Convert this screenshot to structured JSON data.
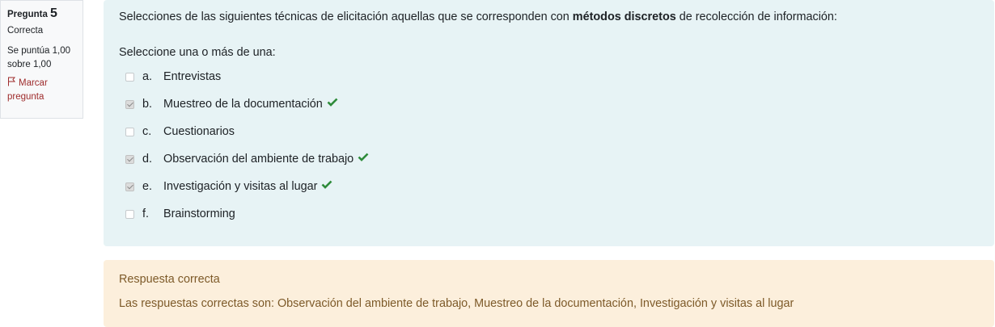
{
  "info": {
    "question_label": "Pregunta",
    "question_number": "5",
    "state": "Correcta",
    "grade": "Se puntúa 1,00 sobre 1,00",
    "flag_label": "Marcar pregunta",
    "flag_color": "#9e2b2b"
  },
  "question": {
    "text_before": "Selecciones de las siguientes técnicas de elicitación aquellas que se corresponden con ",
    "text_bold": "métodos discretos",
    "text_after": " de recolección de información:",
    "prompt": "Seleccione una o más de una:",
    "options": [
      {
        "letter": "a.",
        "label": "Entrevistas",
        "checked": false,
        "correct": false
      },
      {
        "letter": "b.",
        "label": "Muestreo de la documentación",
        "checked": true,
        "correct": true
      },
      {
        "letter": "c.",
        "label": "Cuestionarios",
        "checked": false,
        "correct": false
      },
      {
        "letter": "d.",
        "label": "Observación del ambiente de trabajo",
        "checked": true,
        "correct": true
      },
      {
        "letter": "e.",
        "label": "Investigación y visitas al lugar",
        "checked": true,
        "correct": true
      },
      {
        "letter": "f.",
        "label": "Brainstorming",
        "checked": false,
        "correct": false
      }
    ]
  },
  "feedback": {
    "status": "Respuesta correcta",
    "correct_answers": "Las respuestas correctas son: Observación del ambiente de trabajo, Muestreo de la documentación, Investigación y visitas al lugar"
  },
  "colors": {
    "formulation_bg": "#e7f3f5",
    "feedback_bg": "#fcefdc",
    "feedback_text": "#7d5a29",
    "tick_green": "#2e8b3a"
  }
}
